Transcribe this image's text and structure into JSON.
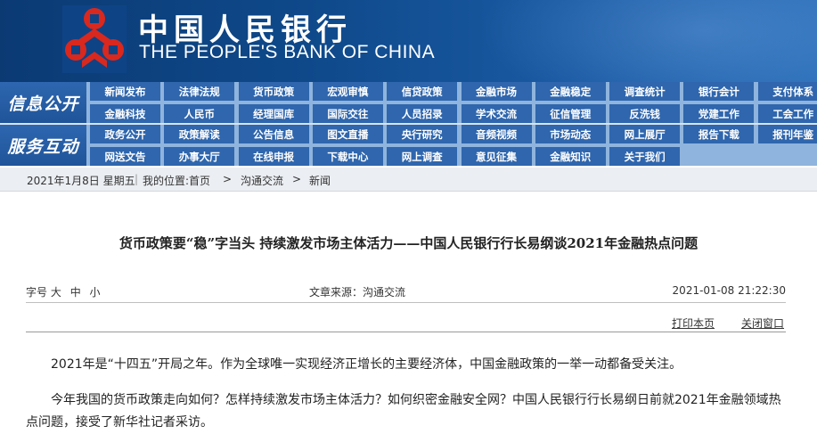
{
  "header": {
    "brand_cn": "中国人民银行",
    "brand_en": "THE PEOPLE'S BANK OF CHINA",
    "logo_icon": "pboc-emblem-icon",
    "bg_color": "#0f4a8c"
  },
  "nav": {
    "section1_label": "信息公开",
    "section2_label": "服务互动",
    "row1": [
      "新闻发布",
      "法律法规",
      "货币政策",
      "宏观审慎",
      "信贷政策",
      "金融市场",
      "金融稳定",
      "调查统计",
      "银行会计",
      "支付体系"
    ],
    "row2": [
      "金融科技",
      "人民币",
      "经理国库",
      "国际交往",
      "人员招录",
      "学术交流",
      "征信管理",
      "反洗钱",
      "党建工作",
      "工会工作"
    ],
    "row3": [
      "政务公开",
      "政策解读",
      "公告信息",
      "图文直播",
      "央行研究",
      "音频视频",
      "市场动态",
      "网上展厅",
      "报告下载",
      "报刊年鉴"
    ],
    "row4": [
      "网送文告",
      "办事大厅",
      "在线申报",
      "下载中心",
      "网上调查",
      "意见征集",
      "金融知识",
      "关于我们"
    ]
  },
  "breadcrumb": {
    "date": "2021年1月8日 星期五",
    "location_label": "我的位置:",
    "home": "首页",
    "sep": ">",
    "level1": "沟通交流",
    "level2": "新闻"
  },
  "article": {
    "title": "货币政策要“稳”字当头 持续激发市场主体活力——中国人民银行行长易纲谈2021年金融热点问题",
    "font_size_label": "字号",
    "font_large": "大",
    "font_medium": "中",
    "font_small": "小",
    "source": "文章来源：沟通交流",
    "datetime": "2021-01-08 21:22:30",
    "print_label": "打印本页",
    "close_label": "关闭窗口",
    "paragraphs": [
      "2021年是“十四五”开局之年。作为全球唯一实现经济正增长的主要经济体，中国金融政策的一举一动都备受关注。",
      "今年我国的货币政策走向如何？怎样持续激发市场主体活力？如何织密金融安全网？中国人民银行行长易纲日前就2021年金融领域热点问题，接受了新华社记者采访。"
    ]
  }
}
